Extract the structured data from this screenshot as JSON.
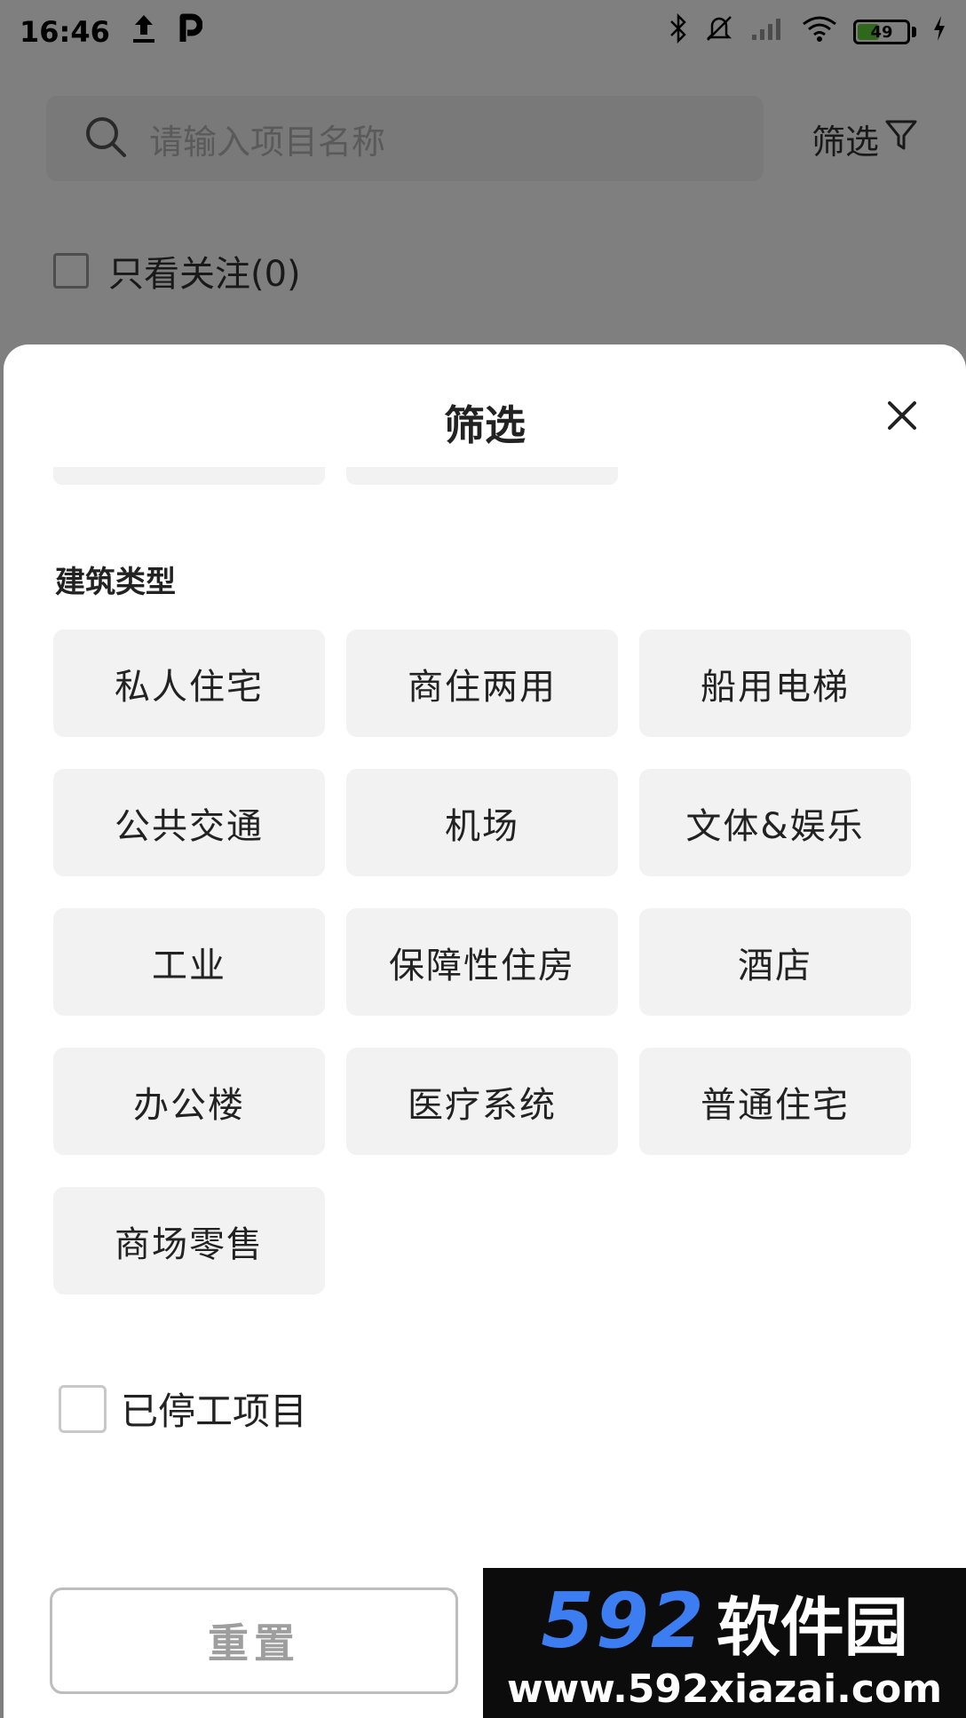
{
  "status_bar": {
    "time": "16:46",
    "battery_level": 49,
    "battery_label": "49",
    "icons": [
      "upload-icon",
      "p-app-icon",
      "bluetooth-icon",
      "mute-icon",
      "signal-icon",
      "wifi-icon",
      "battery-icon",
      "charging-icon"
    ]
  },
  "search": {
    "placeholder": "请输入项目名称",
    "filter_label": "筛选"
  },
  "follow_filter": {
    "label": "只看关注(0)",
    "checked": false
  },
  "sheet": {
    "title": "筛选",
    "section_title": "建筑类型",
    "options": [
      {
        "label": "私人住宅"
      },
      {
        "label": "商住两用"
      },
      {
        "label": "船用电梯"
      },
      {
        "label": "公共交通"
      },
      {
        "label": "机场"
      },
      {
        "label": "文体&娱乐"
      },
      {
        "label": "工业"
      },
      {
        "label": "保障性住房"
      },
      {
        "label": "酒店"
      },
      {
        "label": "办公楼"
      },
      {
        "label": "医疗系统"
      },
      {
        "label": "普通住宅"
      },
      {
        "label": "商场零售"
      }
    ],
    "stopped_projects": {
      "label": "已停工项目",
      "checked": false
    },
    "reset_label": "重置"
  },
  "watermark": {
    "number": "592",
    "name": "软件园",
    "url": "www.592xiazai.com"
  },
  "colors": {
    "chip_background": "#f2f2f2",
    "overlay": "rgba(0,0,0,0.5)",
    "watermark_blue": "#3c7df2",
    "battery_green": "#5fd13a"
  }
}
